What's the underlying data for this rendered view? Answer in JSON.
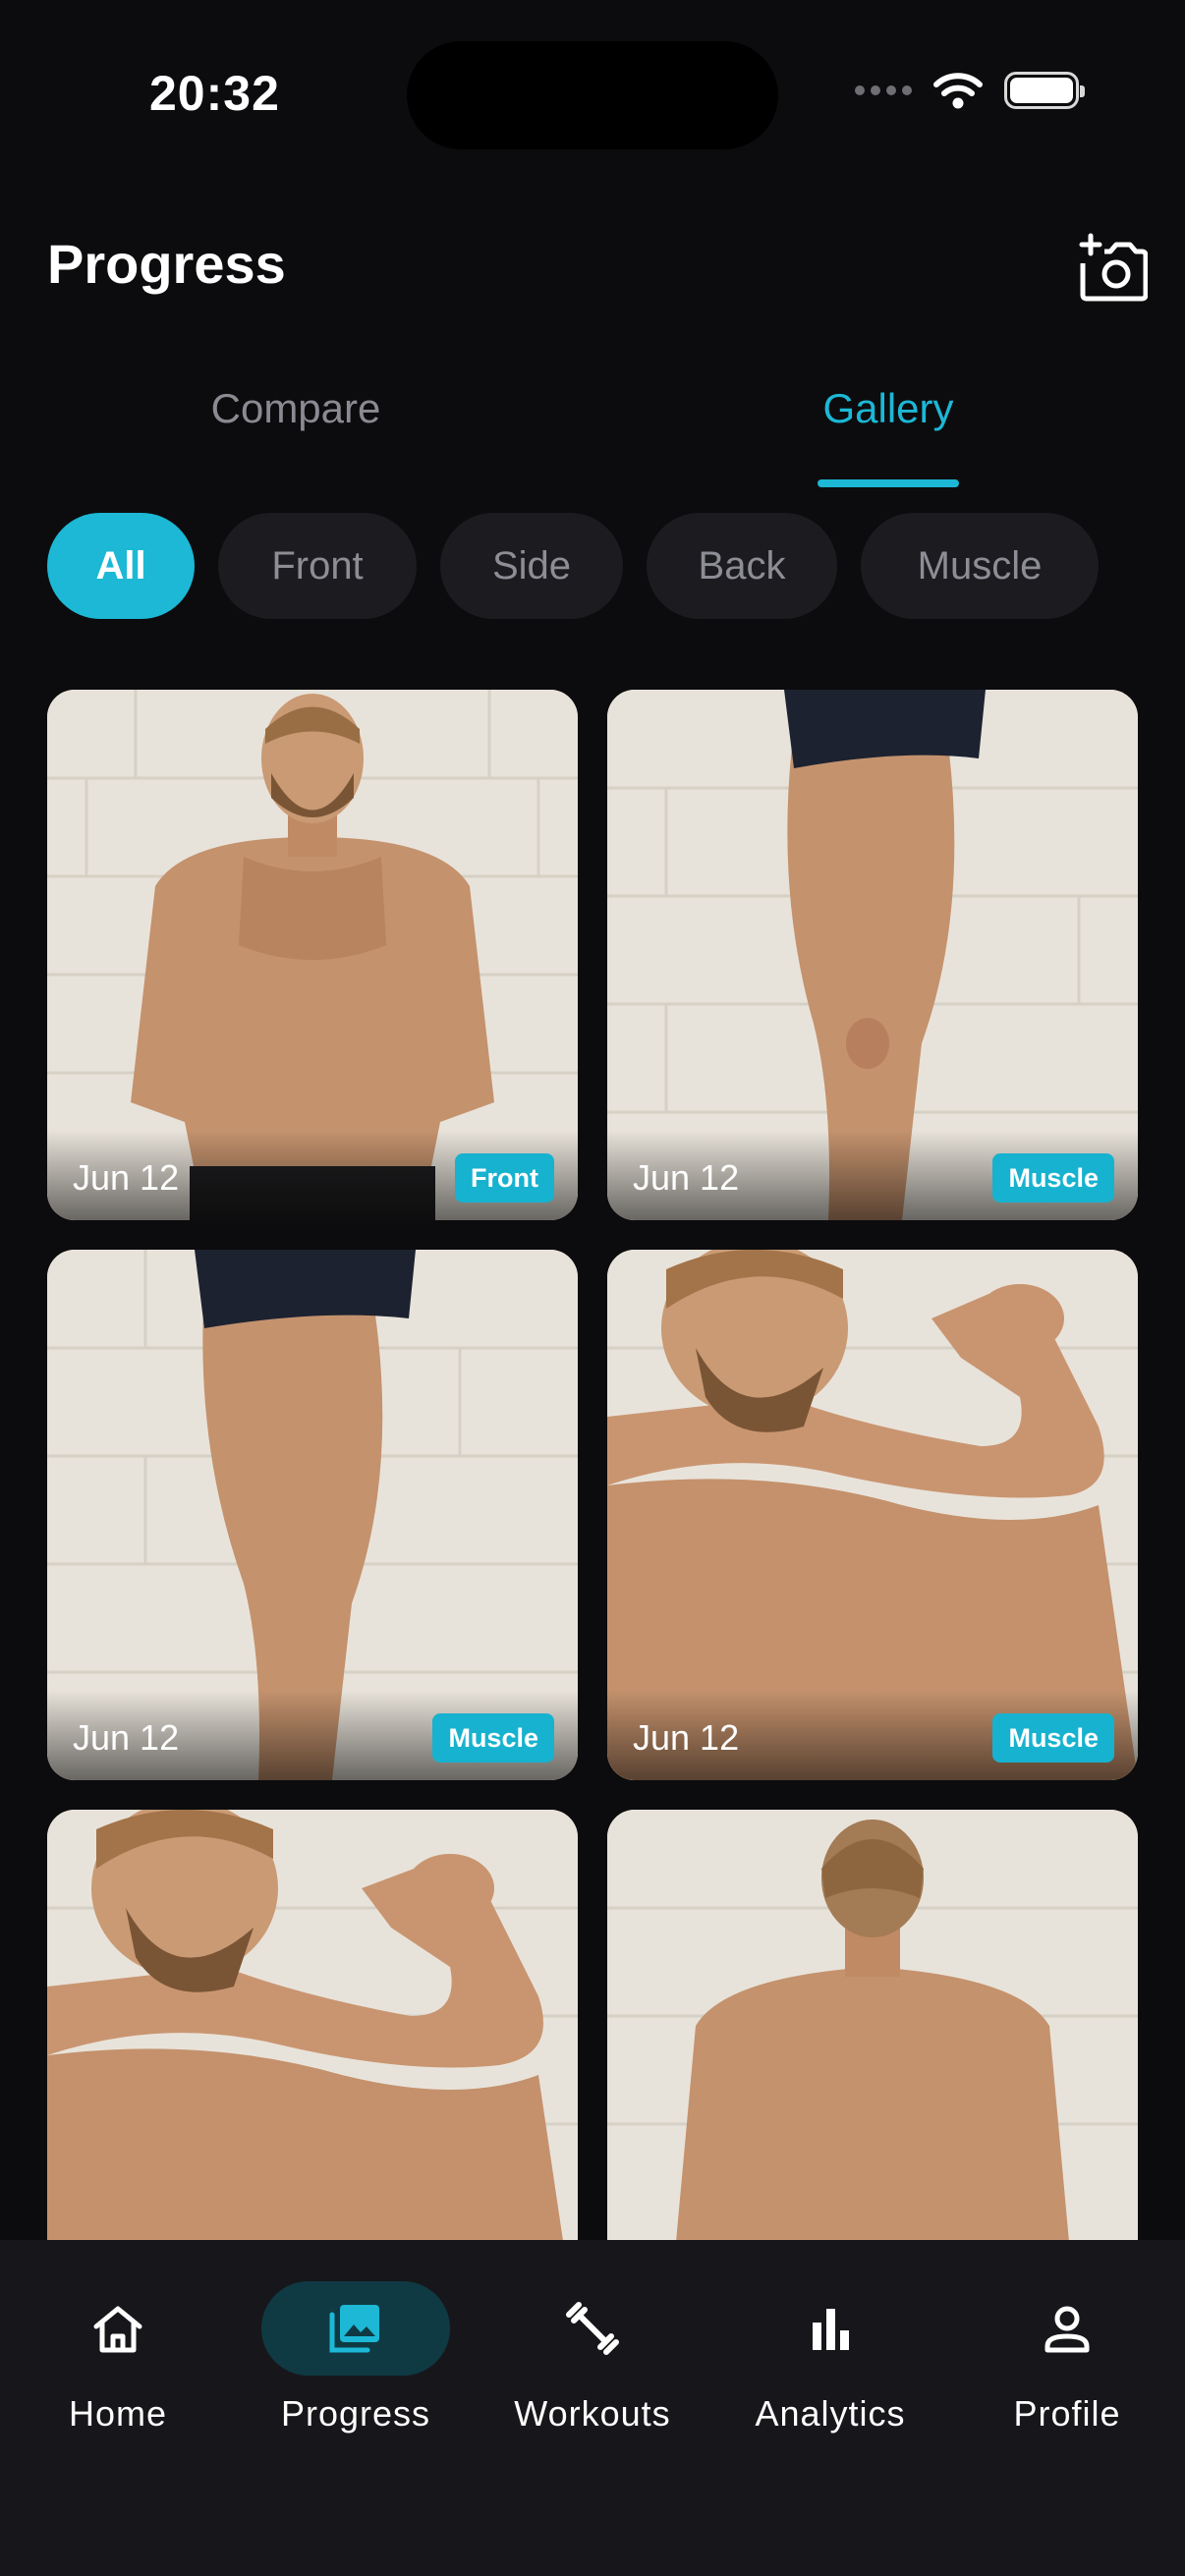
{
  "status_bar": {
    "time": "20:32"
  },
  "header": {
    "title": "Progress",
    "add_photo_icon": "add-photo-camera-icon"
  },
  "tabs": [
    {
      "label": "Compare",
      "active": false
    },
    {
      "label": "Gallery",
      "active": true
    }
  ],
  "filters": [
    {
      "label": "All",
      "active": true
    },
    {
      "label": "Front",
      "active": false
    },
    {
      "label": "Side",
      "active": false
    },
    {
      "label": "Back",
      "active": false
    },
    {
      "label": "Muscle",
      "active": false
    }
  ],
  "gallery": [
    {
      "date": "Jun 12",
      "tag": "Front"
    },
    {
      "date": "Jun 12",
      "tag": "Muscle"
    },
    {
      "date": "Jun 12",
      "tag": "Muscle"
    },
    {
      "date": "Jun 12",
      "tag": "Muscle"
    },
    {
      "date": "",
      "tag": ""
    },
    {
      "date": "",
      "tag": ""
    }
  ],
  "nav": [
    {
      "label": "Home",
      "icon": "home-icon",
      "active": false
    },
    {
      "label": "Progress",
      "icon": "gallery-icon",
      "active": true
    },
    {
      "label": "Workouts",
      "icon": "dumbbell-icon",
      "active": false
    },
    {
      "label": "Analytics",
      "icon": "bar-chart-icon",
      "active": false
    },
    {
      "label": "Profile",
      "icon": "person-icon",
      "active": false
    }
  ],
  "colors": {
    "accent": "#1cb8d6",
    "background": "#0c0c0e",
    "nav_background": "#17171b",
    "chip_background": "#1c1c20"
  }
}
